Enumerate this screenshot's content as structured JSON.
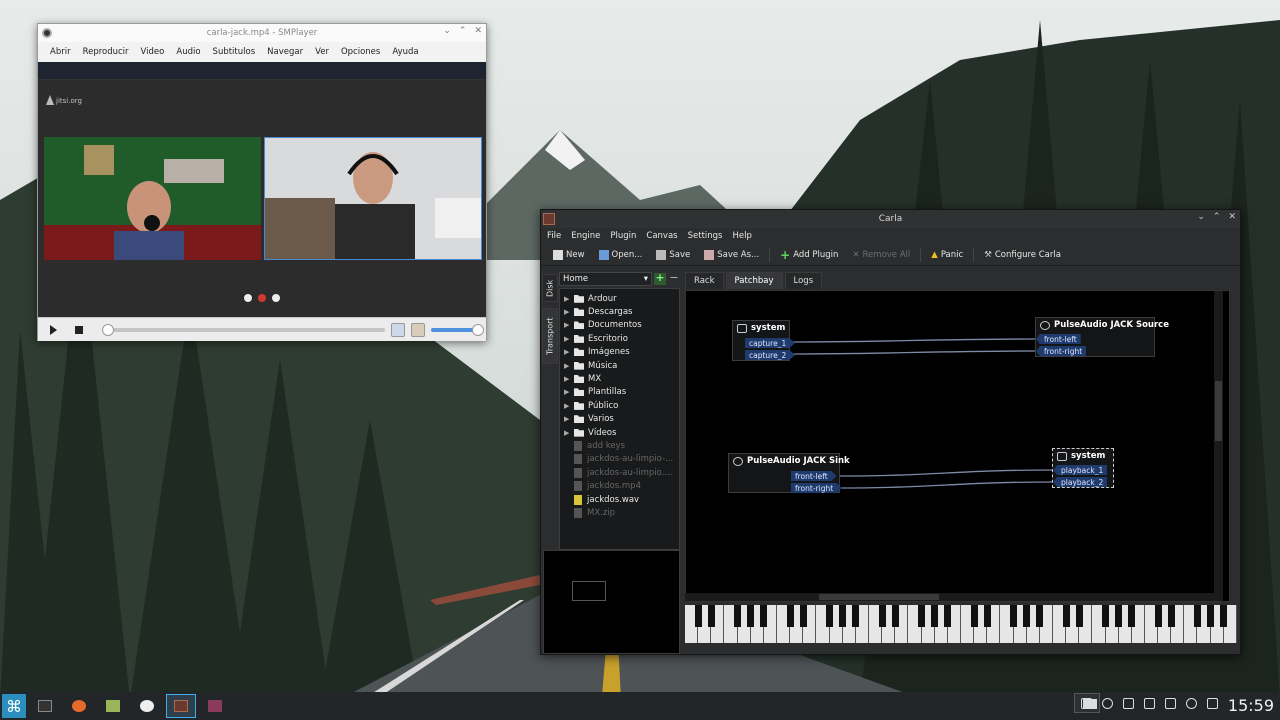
{
  "smplayer": {
    "title": "carla-jack.mp4 - SMPlayer",
    "menu": [
      "Abrir",
      "Reproducir",
      "Video",
      "Audio",
      "Subtitulos",
      "Navegar",
      "Ver",
      "Opciones",
      "Ayuda"
    ],
    "video_watermark": "jitsi.org"
  },
  "carla": {
    "title": "Carla",
    "menu": [
      "File",
      "Engine",
      "Plugin",
      "Canvas",
      "Settings",
      "Help"
    ],
    "toolbar": {
      "new": "New",
      "open": "Open...",
      "save": "Save",
      "save_as": "Save As...",
      "add_plugin": "Add Plugin",
      "remove_all": "Remove All",
      "panic": "Panic",
      "configure": "Configure Carla"
    },
    "side_tabs": [
      "Disk",
      "Transport"
    ],
    "file_browser": {
      "location": "Home",
      "folders": [
        "Ardour",
        "Descargas",
        "Documentos",
        "Escritorio",
        "Imágenes",
        "Música",
        "MX",
        "Plantillas",
        "Público",
        "Varios",
        "Vídeos"
      ],
      "files": [
        {
          "name": "add keys",
          "dim": true
        },
        {
          "name": "jackdos-au-limpio-...",
          "dim": true
        },
        {
          "name": "jackdos-au-limpio....",
          "dim": true
        },
        {
          "name": "jackdos.mp4",
          "dim": true
        },
        {
          "name": "jackdos.wav",
          "dim": false
        },
        {
          "name": "MX.zip",
          "dim": true
        }
      ]
    },
    "tabs": [
      "Rack",
      "Patchbay",
      "Logs"
    ],
    "active_tab": "Patchbay",
    "patchbay": {
      "system_capture": {
        "name": "system",
        "ports": [
          "capture_1",
          "capture_2"
        ]
      },
      "pulse_source": {
        "name": "PulseAudio JACK Source",
        "ports": [
          "front-left",
          "front-right"
        ]
      },
      "pulse_sink": {
        "name": "PulseAudio JACK Sink",
        "ports": [
          "front-left",
          "front-right"
        ]
      },
      "system_playback": {
        "name": "system",
        "ports": [
          "playback_1",
          "playback_2"
        ]
      }
    }
  },
  "taskbar": {
    "clock": "15:59"
  }
}
